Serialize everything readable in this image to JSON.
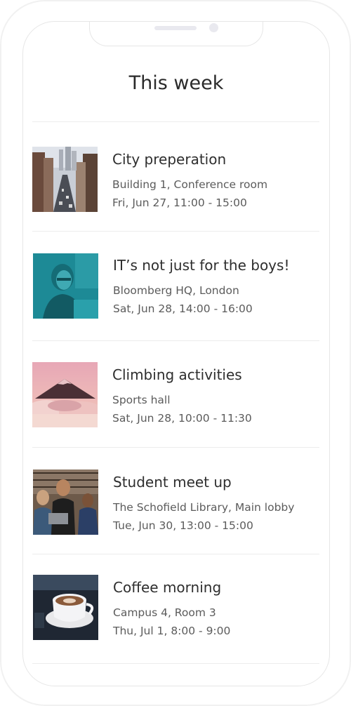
{
  "header": {
    "title": "This week"
  },
  "events": [
    {
      "title": "City preperation",
      "location": "Building 1, Conference room",
      "time": "Fri, Jun 27, 11:00 - 15:00",
      "image": "city-street-image"
    },
    {
      "title": "IT’s not just for the boys!",
      "location": "Bloomberg HQ, London",
      "time": "Sat, Jun 28, 14:00 - 16:00",
      "image": "woman-laptop-image"
    },
    {
      "title": "Climbing activities",
      "location": "Sports hall",
      "time": "Sat, Jun 28, 10:00 - 11:30",
      "image": "mountain-image"
    },
    {
      "title": "Student meet up",
      "location": "The Schofield Library, Main lobby",
      "time": "Tue, Jun 30, 13:00 - 15:00",
      "image": "students-image"
    },
    {
      "title": "Coffee morning",
      "location": "Campus 4, Room 3",
      "time": "Thu, Jul 1, 8:00 - 9:00",
      "image": "coffee-cup-image"
    }
  ],
  "colors": {
    "accent_teal": "#1d8a96",
    "divider": "#ececec"
  }
}
